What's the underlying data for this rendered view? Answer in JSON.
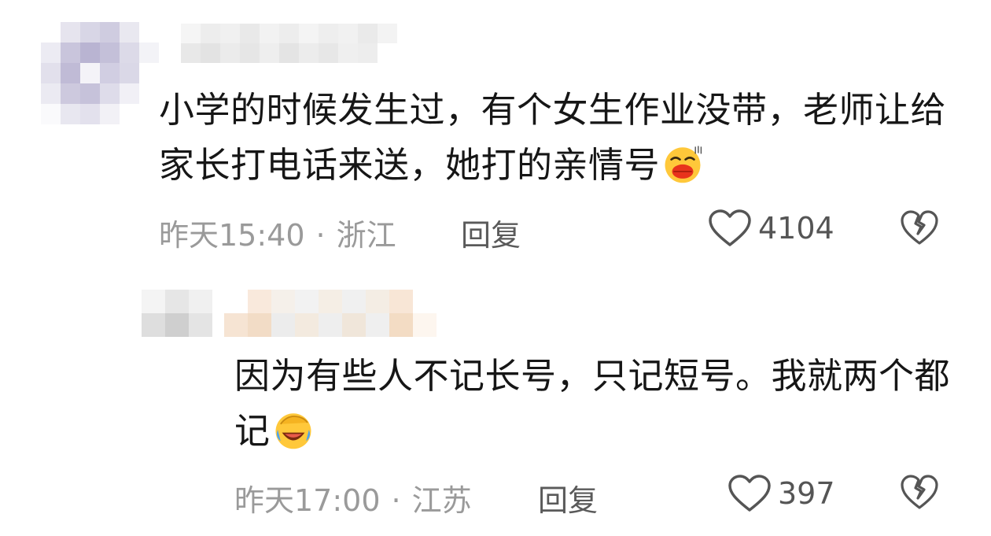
{
  "comments": [
    {
      "text": "小学的时候发生过，有个女生作业没带，老师让给家长打电话来送，她打的亲情号",
      "emoji": "smirk-face-emoji",
      "time": "昨天15:40",
      "separator": "·",
      "location": "浙江",
      "reply_label": "回复",
      "likes": "4104"
    },
    {
      "text": "因为有些人不记长号，只记短号。我就两个都记",
      "emoji": "facepalm-laugh-emoji",
      "time": "昨天17:00",
      "separator": "·",
      "location": "江苏",
      "reply_label": "回复",
      "likes": "397"
    }
  ],
  "icons": {
    "like": "heart-outline-icon",
    "dislike": "broken-heart-icon"
  },
  "colors": {
    "text": "#161616",
    "meta": "#9a9a9a",
    "reply": "#5a5a5a"
  }
}
